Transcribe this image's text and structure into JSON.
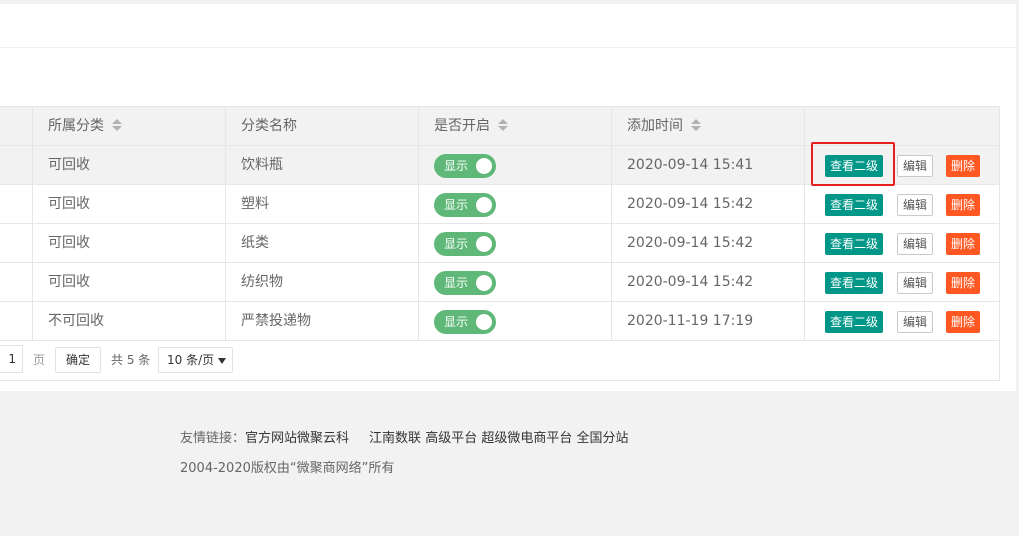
{
  "table": {
    "headers": {
      "category": "所属分类",
      "name": "分类名称",
      "enabled": "是否开启",
      "added_time": "添加时间"
    },
    "rows": [
      {
        "category": "可回收",
        "name": "饮料瓶",
        "switch_label": "显示",
        "time": "2020-09-14 15:41"
      },
      {
        "category": "可回收",
        "name": "塑料",
        "switch_label": "显示",
        "time": "2020-09-14 15:42"
      },
      {
        "category": "可回收",
        "name": "纸类",
        "switch_label": "显示",
        "time": "2020-09-14 15:42"
      },
      {
        "category": "可回收",
        "name": "纺织物",
        "switch_label": "显示",
        "time": "2020-09-14 15:42"
      },
      {
        "category": "不可回收",
        "name": "严禁投递物",
        "switch_label": "显示",
        "time": "2020-11-19 17:19"
      }
    ],
    "actions": {
      "view": "查看二级",
      "edit": "编辑",
      "delete": "删除"
    }
  },
  "pagination": {
    "page_value": "1",
    "page_unit": "页",
    "confirm": "确定",
    "total": "共 5 条",
    "page_size": "10 条/页"
  },
  "footer": {
    "links_label": "友情链接：",
    "links": [
      "官方网站微聚云科",
      "江南数联",
      "高级平台",
      "超级微电商平台",
      "全国分站"
    ],
    "copyright": "2004-2020版权由“微聚商网络”所有"
  },
  "colors": {
    "switch_on": "#5fb878",
    "view_button": "#009688",
    "delete_button": "#ff5722",
    "highlight_box": "#e81f1f"
  }
}
